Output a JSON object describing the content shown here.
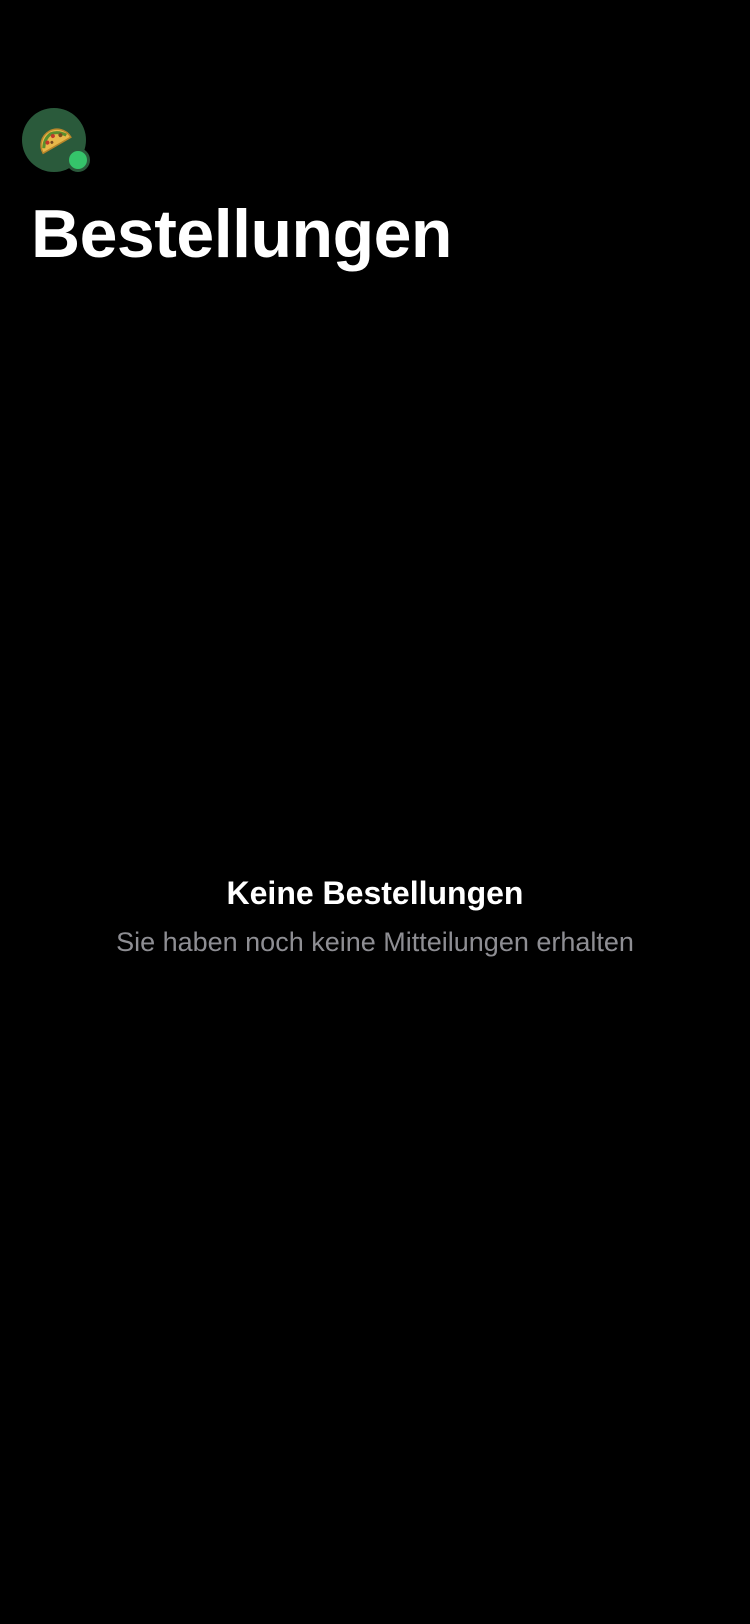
{
  "header": {
    "avatar": {
      "icon": "taco-icon",
      "background_color": "#2a5a3b",
      "status": "online",
      "status_color": "#35c46a"
    },
    "title": "Bestellungen"
  },
  "empty_state": {
    "title": "Keine Bestellungen",
    "subtitle": "Sie haben noch keine Mitteilungen erhalten"
  }
}
